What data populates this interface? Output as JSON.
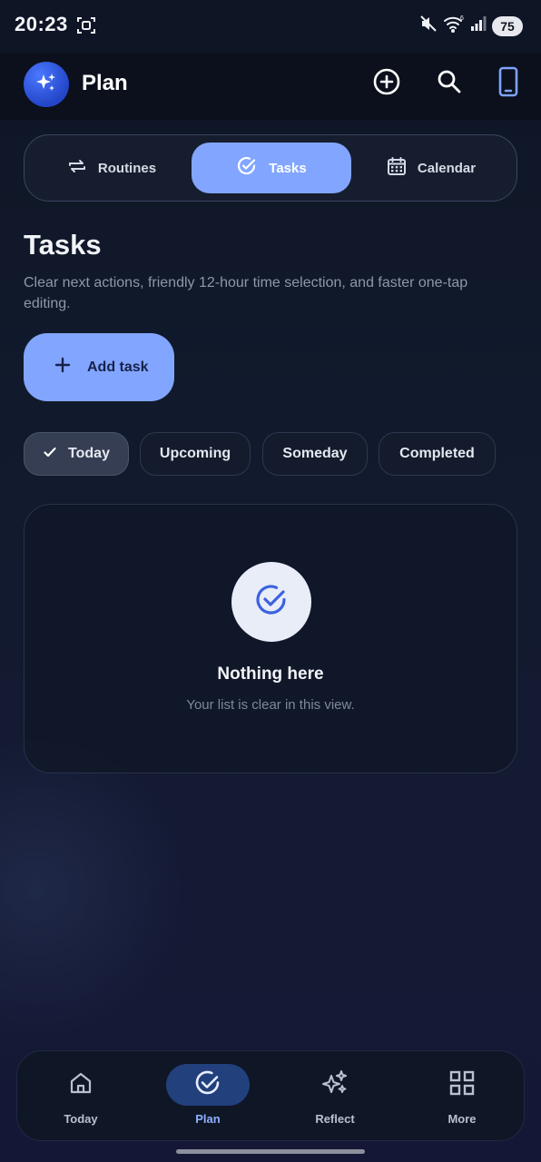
{
  "status_bar": {
    "time": "20:23",
    "battery": "75"
  },
  "app_bar": {
    "title": "Plan"
  },
  "tabs": [
    {
      "label": "Routines",
      "icon": "repeat-icon",
      "active": false
    },
    {
      "label": "Tasks",
      "icon": "check-circle-icon",
      "active": true
    },
    {
      "label": "Calendar",
      "icon": "calendar-icon",
      "active": false
    }
  ],
  "page": {
    "title": "Tasks",
    "subtitle": "Clear next actions, friendly 12-hour time selection, and faster one-tap editing.",
    "add_button_label": "Add task"
  },
  "filters": [
    {
      "label": "Today",
      "selected": true
    },
    {
      "label": "Upcoming",
      "selected": false
    },
    {
      "label": "Someday",
      "selected": false
    },
    {
      "label": "Completed",
      "selected": false
    }
  ],
  "empty_state": {
    "title": "Nothing here",
    "message": "Your list is clear in this view."
  },
  "bottom_nav": [
    {
      "label": "Today",
      "icon": "home-icon",
      "active": false
    },
    {
      "label": "Plan",
      "icon": "check-circle-icon",
      "active": true
    },
    {
      "label": "Reflect",
      "icon": "sparkles-icon",
      "active": false
    },
    {
      "label": "More",
      "icon": "grid-icon",
      "active": false
    }
  ],
  "colors": {
    "accent": "#82a6ff",
    "background": "#111a2c",
    "nav_active": "#22407c",
    "card": "#101828"
  }
}
